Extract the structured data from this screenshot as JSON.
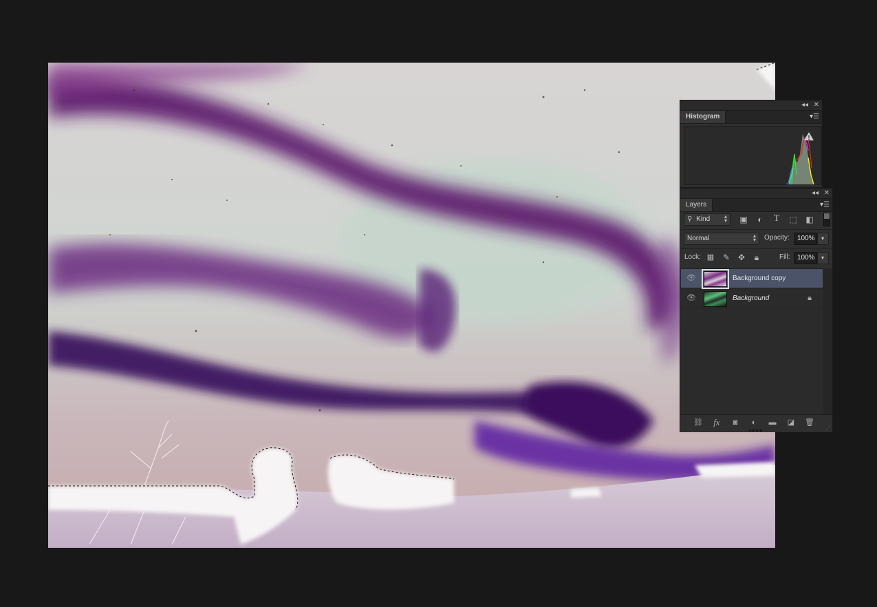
{
  "document": {
    "name": "Inverted aurora photo with snow and trees",
    "selection": "marching-ants selection around white snow/trees areas"
  },
  "histogram_panel": {
    "tab_label": "Histogram",
    "collapse_icon": "double-chevron-left-icon",
    "close_icon": "close-icon",
    "menu_icon": "panel-menu-icon",
    "warning_icon": "cached-data-warning-icon",
    "channels": [
      "red",
      "green",
      "blue",
      "cyan",
      "yellow",
      "magenta"
    ],
    "colors": {
      "red": "#e02a1a",
      "green": "#2fe02a",
      "blue": "#2a3aff",
      "cyan": "#20e0e8",
      "yellow": "#e8e81c",
      "magenta": "#e02ae8",
      "gray": "#8a9a88"
    }
  },
  "layers_panel": {
    "tab_label": "Layers",
    "filter": {
      "value": "Kind",
      "icon": "search-icon"
    },
    "filter_icons": [
      "pixel-layer-filter-icon",
      "adjustment-layer-filter-icon",
      "type-layer-filter-icon",
      "shape-layer-filter-icon",
      "smart-object-filter-icon"
    ],
    "blend_mode": "Normal",
    "opacity_label": "Opacity:",
    "opacity_value": "100%",
    "lock_label": "Lock:",
    "fill_label": "Fill:",
    "fill_value": "100%",
    "layers": [
      {
        "name": "Background copy",
        "selected": true,
        "visible": true,
        "locked": false
      },
      {
        "name": "Background",
        "selected": false,
        "visible": true,
        "locked": true
      }
    ],
    "footer_icons": [
      "link-layers-icon",
      "fx-icon",
      "add-mask-icon",
      "adjustment-icon",
      "new-group-icon",
      "new-layer-icon",
      "delete-icon"
    ]
  },
  "colors": {
    "app_bg": "#181818",
    "panel_bg": "#2f2f2f",
    "selected_row": "#4b5368"
  }
}
